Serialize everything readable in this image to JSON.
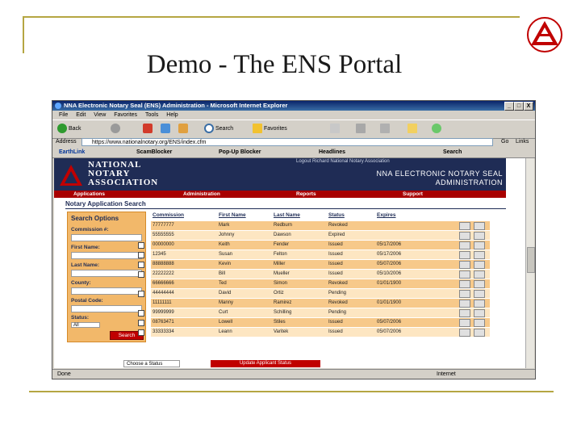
{
  "slide": {
    "title": "Demo - The ENS Portal"
  },
  "window": {
    "title": "NNA Electronic Notary Seal (ENS) Administration - Microsoft Internet Explorer",
    "buttons": [
      "_",
      "□",
      "X"
    ]
  },
  "menu": [
    "File",
    "Edit",
    "View",
    "Favorites",
    "Tools",
    "Help"
  ],
  "toolbar": {
    "back": "Back",
    "search": "Search",
    "favorites": "Favorites"
  },
  "address": {
    "label": "Address",
    "url": "https://www.nationalnotary.org/ENS/index.cfm",
    "go": "Go",
    "links": "Links"
  },
  "linksbar": {
    "earthlink": "EarthLink",
    "scamblocker": "ScamBlocker",
    "popup": "Pop-Up Blocker",
    "headlines": "Headlines",
    "search": "Search"
  },
  "site": {
    "name": [
      "NATIONAL",
      "NOTARY",
      "ASSOCIATION"
    ],
    "admin_line1": "NNA ELECTRONIC NOTARY SEAL",
    "admin_line2": "ADMINISTRATION",
    "top_links": "Logout Richard     National Notary Association",
    "nav": [
      "Applications",
      "Administration",
      "Reports",
      "Support"
    ],
    "page_heading": "Notary Application Search"
  },
  "search": {
    "title": "Search Options",
    "fields": [
      "Commission #:",
      "First Name:",
      "Last Name:",
      "County:",
      "Postal Code:"
    ],
    "status_label": "Status:",
    "status_value": "All",
    "button": "Search"
  },
  "results": {
    "columns": [
      "Commission",
      "First Name",
      "Last Name",
      "Status",
      "Expires"
    ],
    "rows": [
      {
        "commission": "77777777",
        "first": "Mark",
        "last": "Redburn",
        "status": "Revoked",
        "expires": "",
        "checkbox": false
      },
      {
        "commission": "55555555",
        "first": "Johnny",
        "last": "Dawson",
        "status": "Expired",
        "expires": "",
        "checkbox": false
      },
      {
        "commission": "00000000",
        "first": "Keith",
        "last": "Fender",
        "status": "Issued",
        "expires": "05/17/2006",
        "checkbox": true
      },
      {
        "commission": "12345",
        "first": "Susan",
        "last": "Felton",
        "status": "Issued",
        "expires": "05/17/2006",
        "checkbox": true
      },
      {
        "commission": "88888888",
        "first": "Kevin",
        "last": "Miller",
        "status": "Issued",
        "expires": "05/07/2006",
        "checkbox": true
      },
      {
        "commission": "22222222",
        "first": "Bill",
        "last": "Mueller",
        "status": "Issued",
        "expires": "05/10/2006",
        "checkbox": true
      },
      {
        "commission": "66666666",
        "first": "Ted",
        "last": "Simon",
        "status": "Revoked",
        "expires": "01/01/1900",
        "checkbox": false
      },
      {
        "commission": "44444444",
        "first": "David",
        "last": "Ortiz",
        "status": "Pending",
        "expires": "",
        "checkbox": true
      },
      {
        "commission": "11111111",
        "first": "Manny",
        "last": "Ramirez",
        "status": "Revoked",
        "expires": "01/01/1900",
        "checkbox": false
      },
      {
        "commission": "99999999",
        "first": "Curt",
        "last": "Schilling",
        "status": "Pending",
        "expires": "",
        "checkbox": true
      },
      {
        "commission": "08763471",
        "first": "Lowell",
        "last": "Stiles",
        "status": "Issued",
        "expires": "05/07/2006",
        "checkbox": true
      },
      {
        "commission": "33333334",
        "first": "Leann",
        "last": "Varitek",
        "status": "Issued",
        "expires": "05/07/2006",
        "checkbox": true
      }
    ],
    "choose_status": "Choose a Status",
    "update_button": "Update Applicant Status"
  },
  "status": {
    "left": "Done",
    "zone": "Internet"
  },
  "colors": {
    "navy": "#1f2c55",
    "red": "#a80000",
    "orange": "#f2b86a",
    "olive": "#b5a642"
  }
}
